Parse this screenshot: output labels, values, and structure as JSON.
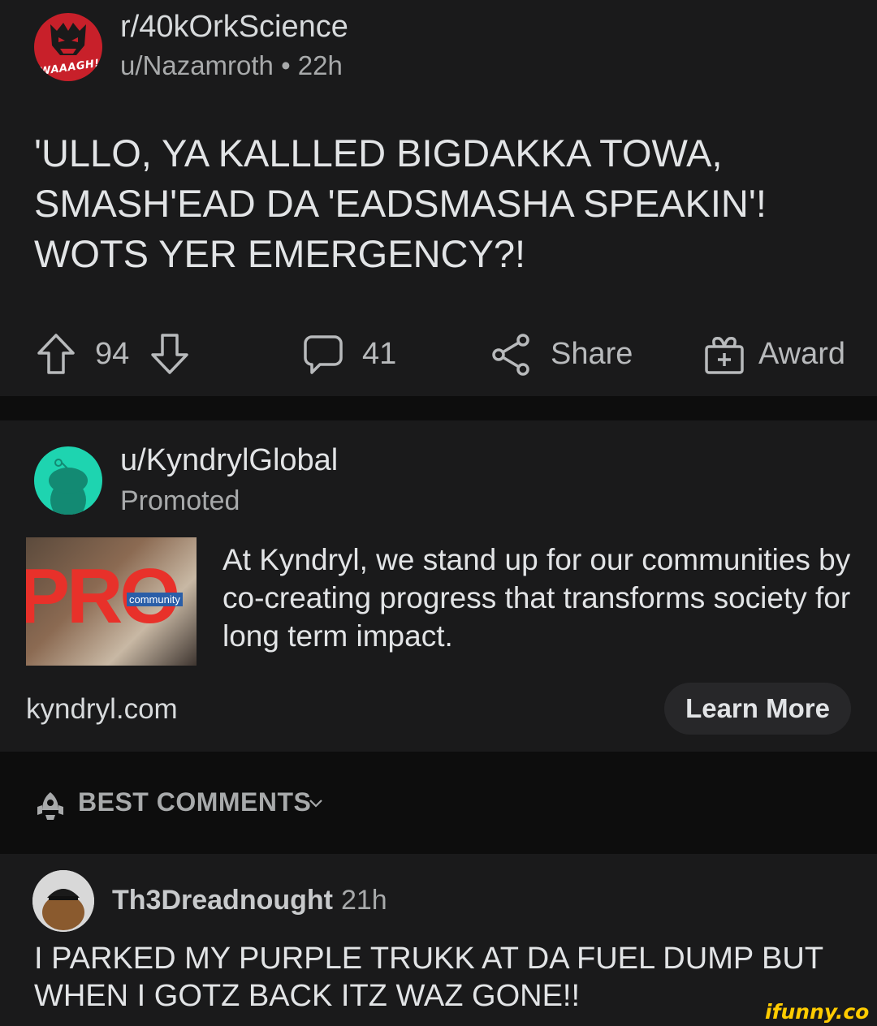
{
  "post": {
    "subreddit": "r/40kOrkScience",
    "user_line": "u/Nazamroth • 22h",
    "avatar_text": "WAAAGH!",
    "title": "'ULLO, YA KALLLED BIGDAKKA TOWA, SMASH'EAD DA 'EADSMASHA SPEAKIN'! WOTS YER EMERGENCY?!",
    "upvotes": "94",
    "comments": "41",
    "share_label": "Share",
    "award_label": "Award"
  },
  "promo": {
    "user": "u/KyndrylGlobal",
    "tag": "Promoted",
    "image_big_text": "PRO",
    "image_small_text": "community",
    "text": "At Kyndryl, we stand up for our communities by co-creating progress that transforms society for long term impact.",
    "domain": "kyndryl.com",
    "cta": "Learn More"
  },
  "sort": {
    "label": "BEST COMMENTS"
  },
  "comment": {
    "user": "Th3Dreadnought",
    "time": "21h",
    "body": "I PARKED MY PURPLE TRUKK AT DA FUEL DUMP BUT WHEN I GOTZ BACK ITZ WAZ GONE!!"
  },
  "watermark": "ifunny.co",
  "colors": {
    "background": "#1a1a1b",
    "divider": "#0d0d0d",
    "sub_avatar": "#c8202a",
    "promo_avatar": "#1ed4b0",
    "watermark": "#ffcc00"
  }
}
